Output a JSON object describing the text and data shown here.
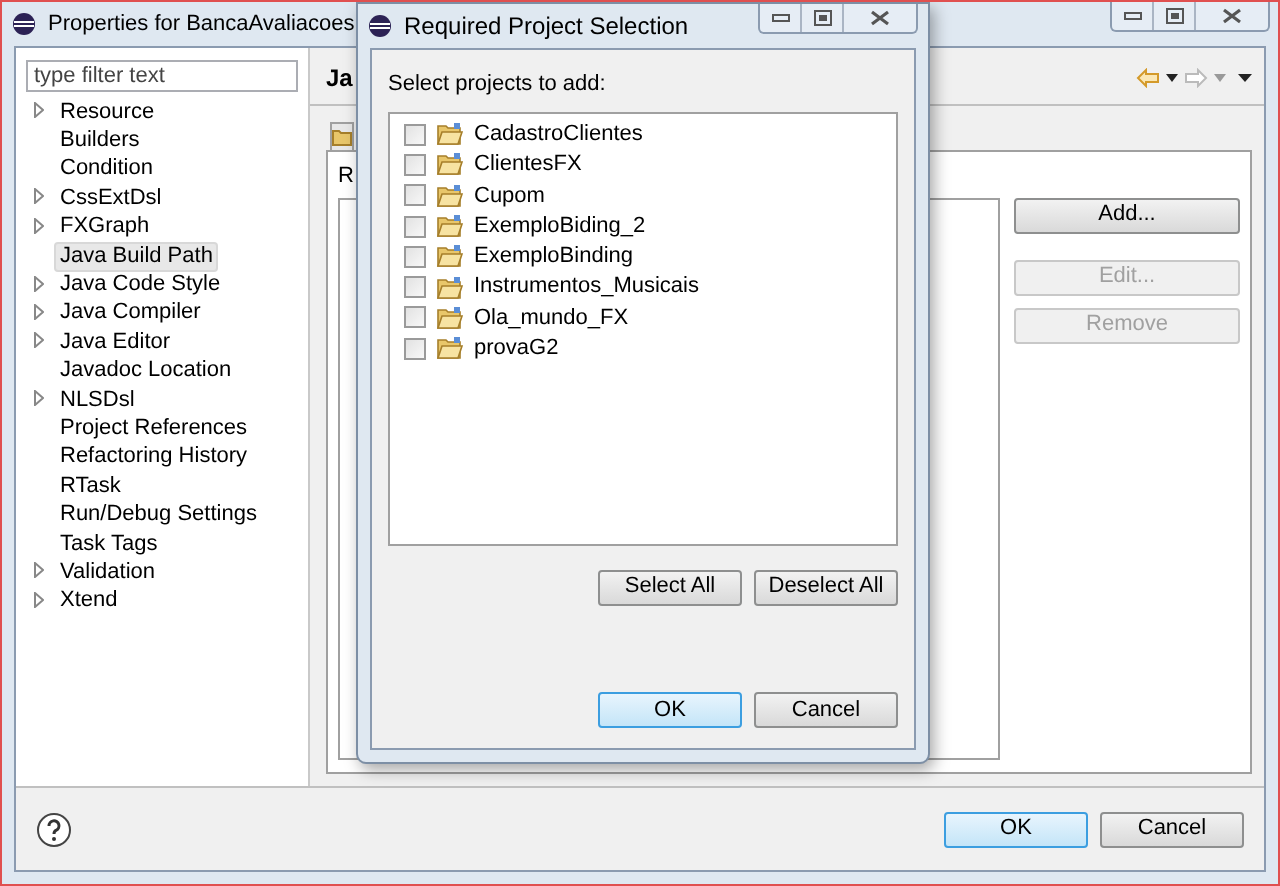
{
  "window": {
    "title": "Properties for BancaAvaliacoes"
  },
  "filter": {
    "placeholder": "type filter text"
  },
  "sidebar": {
    "items": [
      {
        "label": "Resource",
        "expandable": true,
        "selected": false
      },
      {
        "label": "Builders",
        "expandable": false,
        "selected": false
      },
      {
        "label": "Condition",
        "expandable": false,
        "selected": false
      },
      {
        "label": "CssExtDsl",
        "expandable": true,
        "selected": false
      },
      {
        "label": "FXGraph",
        "expandable": true,
        "selected": false
      },
      {
        "label": "Java Build Path",
        "expandable": false,
        "selected": true
      },
      {
        "label": "Java Code Style",
        "expandable": true,
        "selected": false
      },
      {
        "label": "Java Compiler",
        "expandable": true,
        "selected": false
      },
      {
        "label": "Java Editor",
        "expandable": true,
        "selected": false
      },
      {
        "label": "Javadoc Location",
        "expandable": false,
        "selected": false
      },
      {
        "label": "NLSDsl",
        "expandable": true,
        "selected": false
      },
      {
        "label": "Project References",
        "expandable": false,
        "selected": false
      },
      {
        "label": "Refactoring History",
        "expandable": false,
        "selected": false
      },
      {
        "label": "RTask",
        "expandable": false,
        "selected": false
      },
      {
        "label": "Run/Debug Settings",
        "expandable": false,
        "selected": false
      },
      {
        "label": "Task Tags",
        "expandable": false,
        "selected": false
      },
      {
        "label": "Validation",
        "expandable": true,
        "selected": false
      },
      {
        "label": "Xtend",
        "expandable": true,
        "selected": false
      }
    ]
  },
  "page": {
    "heading": "Ja",
    "tab_label": "R",
    "buttons": [
      {
        "label": "Add...",
        "disabled": false
      },
      {
        "label": "Edit...",
        "disabled": true
      },
      {
        "label": "Remove",
        "disabled": true
      }
    ]
  },
  "footer": {
    "buttons": [
      {
        "label": "OK",
        "default": true
      },
      {
        "label": "Cancel",
        "default": false
      }
    ]
  },
  "dialog": {
    "title": "Required Project Selection",
    "prompt": "Select projects to add:",
    "projects": [
      {
        "name": "CadastroClientes",
        "checked": false
      },
      {
        "name": "ClientesFX",
        "checked": false
      },
      {
        "name": "Cupom",
        "checked": false
      },
      {
        "name": "ExemploBiding_2",
        "checked": false
      },
      {
        "name": "ExemploBinding",
        "checked": false
      },
      {
        "name": "Instrumentos_Musicais",
        "checked": false
      },
      {
        "name": "Ola_mundo_FX",
        "checked": false
      },
      {
        "name": "provaG2",
        "checked": false
      }
    ],
    "select_buttons": [
      "Select All",
      "Deselect All"
    ],
    "buttons": [
      {
        "label": "OK",
        "default": true
      },
      {
        "label": "Cancel",
        "default": false
      }
    ]
  }
}
